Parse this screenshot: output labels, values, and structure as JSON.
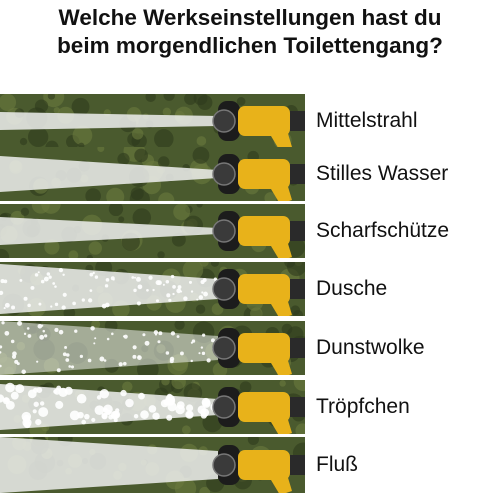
{
  "title": {
    "line1": "Welche Werkseinstellungen hast du",
    "line2": "beim morgendlichen Toilettengang?"
  },
  "settings": [
    {
      "label": "Mittelstrahl",
      "spray": "jet"
    },
    {
      "label": "Stilles Wasser",
      "spray": "cone"
    },
    {
      "label": "Scharfschütze",
      "spray": "sharp"
    },
    {
      "label": "Dusche",
      "spray": "shower"
    },
    {
      "label": "Dunstwolke",
      "spray": "mist"
    },
    {
      "label": "Tröpfchen",
      "spray": "droplets"
    },
    {
      "label": "Fluß",
      "spray": "flood"
    }
  ],
  "colors": {
    "nozzle_yellow": "#e8b21a",
    "nozzle_dark": "#1c1c1c",
    "background_green": "#4a5a2e",
    "water": "#eef0ee"
  }
}
